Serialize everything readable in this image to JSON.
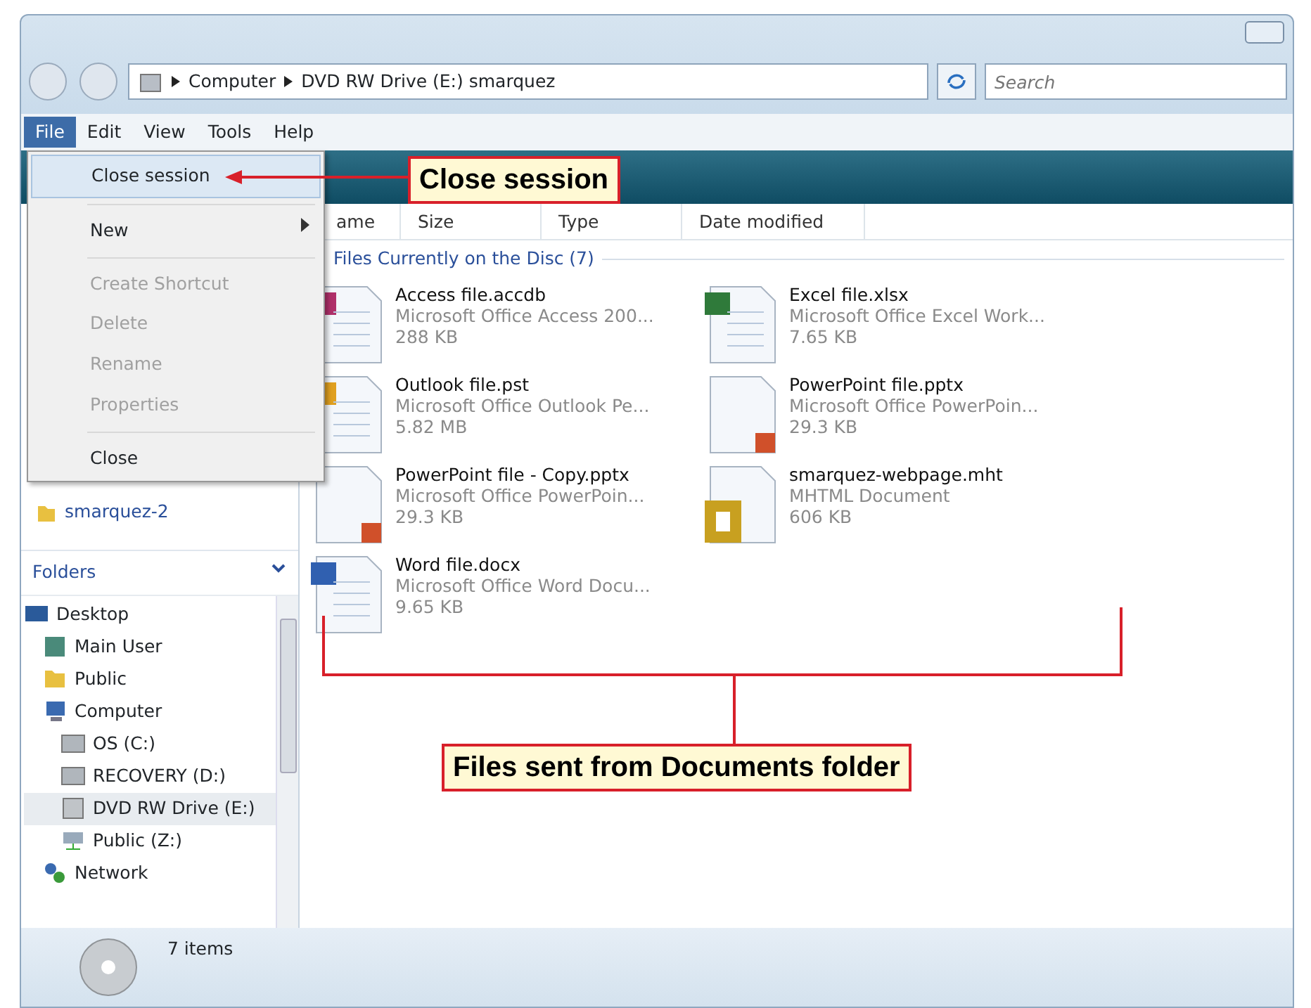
{
  "address_bar": {
    "breadcrumbs": [
      "Computer",
      "DVD RW Drive (E:) smarquez"
    ]
  },
  "search": {
    "placeholder": "Search"
  },
  "menu_bar": [
    {
      "label": "File",
      "selected": true
    },
    {
      "label": "Edit",
      "selected": false
    },
    {
      "label": "View",
      "selected": false
    },
    {
      "label": "Tools",
      "selected": false
    },
    {
      "label": "Help",
      "selected": false
    }
  ],
  "file_menu": [
    {
      "kind": "item",
      "label": "Close session",
      "disabled": false,
      "selected": true,
      "submenu": false
    },
    {
      "kind": "separator"
    },
    {
      "kind": "item",
      "label": "New",
      "disabled": false,
      "selected": false,
      "submenu": true
    },
    {
      "kind": "separator"
    },
    {
      "kind": "item",
      "label": "Create Shortcut",
      "disabled": true,
      "selected": false,
      "submenu": false
    },
    {
      "kind": "item",
      "label": "Delete",
      "disabled": true,
      "selected": false,
      "submenu": false
    },
    {
      "kind": "item",
      "label": "Rename",
      "disabled": true,
      "selected": false,
      "submenu": false
    },
    {
      "kind": "item",
      "label": "Properties",
      "disabled": true,
      "selected": false,
      "submenu": false
    },
    {
      "kind": "separator"
    },
    {
      "kind": "item",
      "label": "Close",
      "disabled": false,
      "selected": false,
      "submenu": false
    }
  ],
  "columns": [
    "ame",
    "Size",
    "Type",
    "Date modified"
  ],
  "group_header": "Files Currently on the Disc (7)",
  "files": [
    {
      "kind": "access",
      "name": "Access file.accdb",
      "type": "Microsoft Office Access 200...",
      "size": "288 KB"
    },
    {
      "kind": "excel",
      "name": "Excel file.xlsx",
      "type": "Microsoft Office Excel Work...",
      "size": "7.65 KB"
    },
    {
      "kind": "outlook",
      "name": "Outlook file.pst",
      "type": "Microsoft Office Outlook Pe...",
      "size": "5.82 MB"
    },
    {
      "kind": "powerpoint",
      "name": "PowerPoint file.pptx",
      "type": "Microsoft Office PowerPoin...",
      "size": "29.3 KB"
    },
    {
      "kind": "powerpoint",
      "name": "PowerPoint file - Copy.pptx",
      "type": "Microsoft Office PowerPoin...",
      "size": "29.3 KB"
    },
    {
      "kind": "mht",
      "name": "smarquez-webpage.mht",
      "type": "MHTML Document",
      "size": "606 KB"
    },
    {
      "kind": "word",
      "name": "Word file.docx",
      "type": "Microsoft Office Word Docu...",
      "size": "9.65 KB"
    }
  ],
  "favorite_links": [
    {
      "label": "smarquez-2"
    }
  ],
  "folders": {
    "title": "Folders",
    "tree": [
      {
        "label": "Desktop",
        "kind": "desktop",
        "selected": false,
        "children": [
          {
            "label": "Main User",
            "kind": "user",
            "selected": false
          },
          {
            "label": "Public",
            "kind": "folder",
            "selected": false
          },
          {
            "label": "Computer",
            "kind": "computer",
            "selected": false,
            "children": [
              {
                "label": "OS (C:)",
                "kind": "drive",
                "selected": false
              },
              {
                "label": "RECOVERY (D:)",
                "kind": "drive",
                "selected": false
              },
              {
                "label": "DVD RW Drive (E:)",
                "kind": "dvd",
                "selected": true
              },
              {
                "label": "Public (Z:)",
                "kind": "netdrive",
                "selected": false
              }
            ]
          },
          {
            "label": "Network",
            "kind": "network",
            "selected": false
          }
        ]
      }
    ]
  },
  "status_bar": {
    "text": "7 items"
  },
  "callouts": [
    {
      "text": "Close session"
    },
    {
      "text": "Files sent from Documents folder"
    }
  ]
}
